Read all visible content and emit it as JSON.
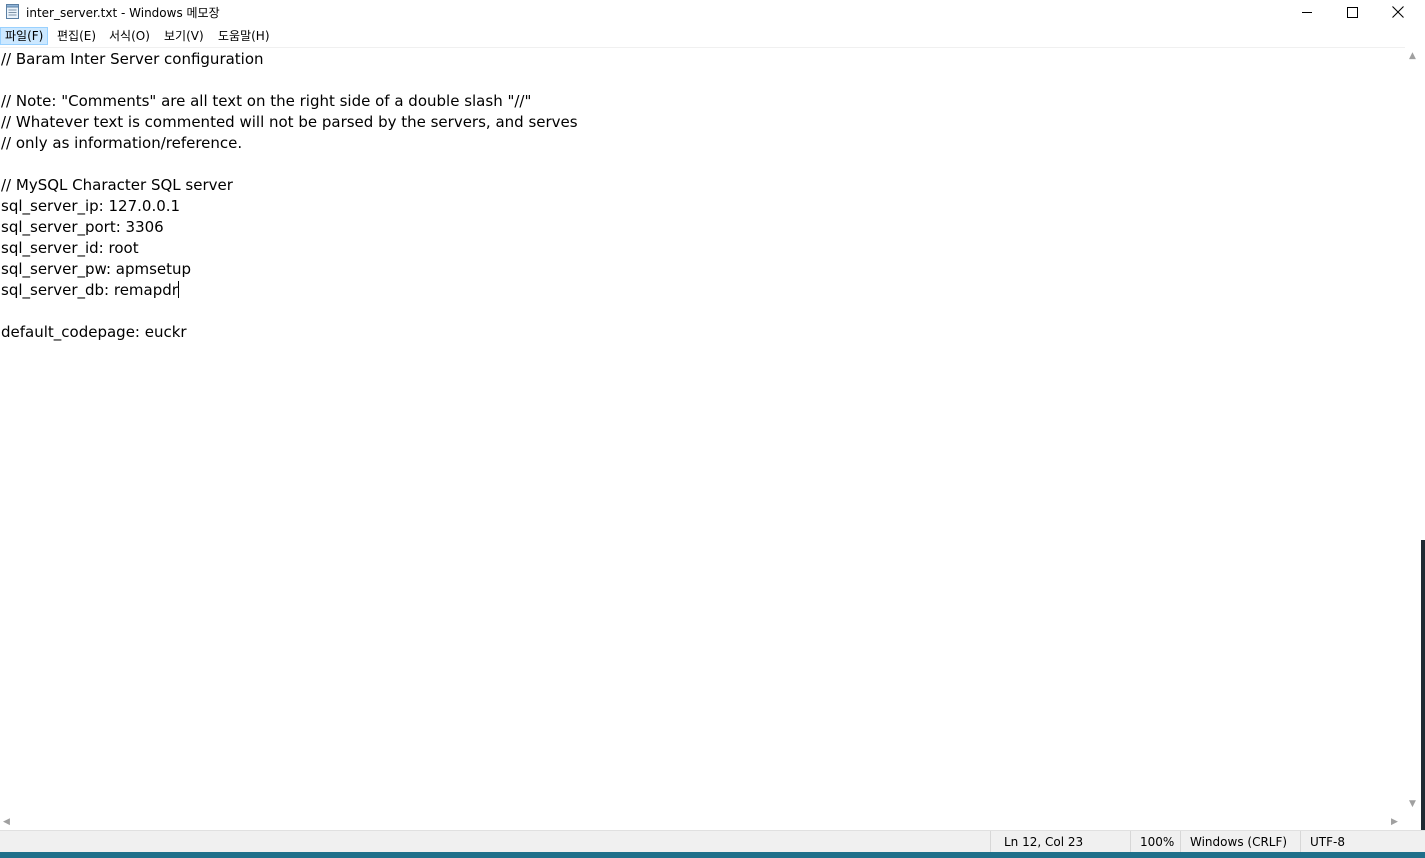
{
  "window": {
    "title": "inter_server.txt - Windows 메모장"
  },
  "menu": {
    "items": [
      {
        "label": "파일(F)"
      },
      {
        "label": "편집(E)"
      },
      {
        "label": "서식(O)"
      },
      {
        "label": "보기(V)"
      },
      {
        "label": "도움말(H)"
      }
    ]
  },
  "editor": {
    "lines": [
      "// Baram Inter Server configuration",
      "",
      "// Note: \"Comments\" are all text on the right side of a double slash \"//\"",
      "// Whatever text is commented will not be parsed by the servers, and serves",
      "// only as information/reference.",
      "",
      "// MySQL Character SQL server",
      "sql_server_ip: 127.0.0.1",
      "sql_server_port: 3306",
      "sql_server_id: root",
      "sql_server_pw: apmsetup",
      "sql_server_db: remapdr",
      "",
      "default_codepage: euckr"
    ]
  },
  "status": {
    "position": "Ln 12, Col 23",
    "zoom": "100%",
    "line_ending": "Windows (CRLF)",
    "encoding": "UTF-8"
  },
  "icons": {
    "app": "notepad-icon",
    "minimize": "minimize-icon",
    "maximize": "maximize-icon",
    "close": "close-icon"
  },
  "colors": {
    "menu_active_bg": "#cce8ff",
    "menu_active_border": "#99d1ff",
    "status_bg": "#f0f0f0",
    "taskbar": "#1e6f8a"
  }
}
